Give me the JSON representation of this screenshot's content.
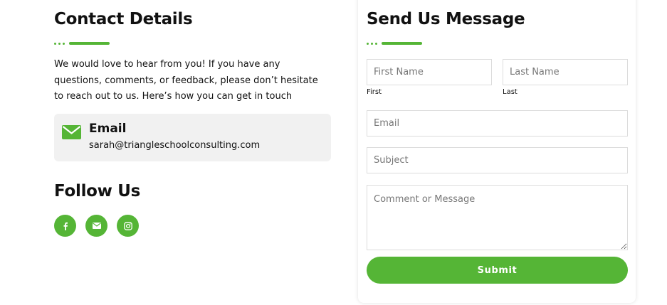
{
  "contact": {
    "title": "Contact Details",
    "intro": "We would love to hear from you! If you have any questions, comments, or feedback, please don’t hesitate to reach out to us. Here’s how you can get in touch",
    "email_card": {
      "icon": "envelope-icon",
      "title": "Email",
      "value": "sarah@triangleschoolconsulting.com"
    }
  },
  "follow": {
    "title": "Follow Us",
    "socials": [
      {
        "name": "facebook",
        "icon": "facebook-icon"
      },
      {
        "name": "email",
        "icon": "envelope-icon"
      },
      {
        "name": "instagram",
        "icon": "instagram-icon"
      }
    ]
  },
  "form": {
    "title": "Send Us Message",
    "first_name": {
      "placeholder": "First Name",
      "value": "",
      "sublabel": "First"
    },
    "last_name": {
      "placeholder": "Last Name",
      "value": "",
      "sublabel": "Last"
    },
    "email": {
      "placeholder": "Email",
      "value": ""
    },
    "subject": {
      "placeholder": "Subject",
      "value": ""
    },
    "message": {
      "placeholder": "Comment or Message",
      "value": ""
    },
    "submit_label": "Submit"
  },
  "colors": {
    "accent": "#55b536",
    "card_bg": "#f1f1f1",
    "text": "#111111",
    "input_border": "#dcdcdc"
  }
}
